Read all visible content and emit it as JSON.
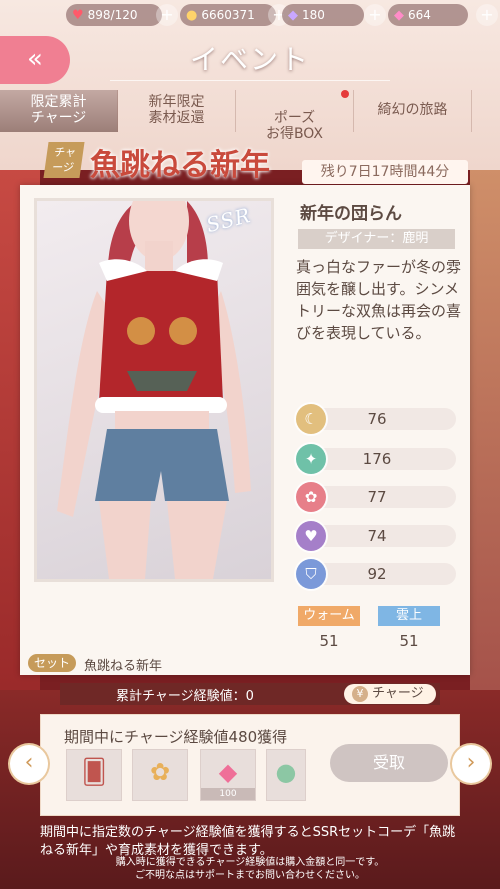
{
  "resources": {
    "stamina": "898/120",
    "coins": "6660371",
    "diamonds_purple": "180",
    "diamonds_pink": "664"
  },
  "header": {
    "back_label": "«",
    "title": "イベント"
  },
  "tabs": [
    {
      "label": "限定累計\nチャージ",
      "active": true
    },
    {
      "label": "新年限定\n素材返還"
    },
    {
      "label": "ポーズ\nお得BOX",
      "badge": true
    },
    {
      "label": "綺幻の旅路"
    }
  ],
  "event": {
    "tag": "チャ\nージ",
    "name": "魚跳ねる新年",
    "remaining": "残り7日17時間44分"
  },
  "item": {
    "rarity": "SSR",
    "name": "新年の団らん",
    "designer": "デザイナー：鹿明",
    "description": "真っ白なファーが冬の雰囲気を醸し出す。シンメトリーな双魚は再会の喜びを表現している。",
    "stats": [
      {
        "icon": "moon-icon",
        "value": "76",
        "color": "#e2bf7e"
      },
      {
        "icon": "sparkle-icon",
        "value": "176",
        "color": "#6fc1a8"
      },
      {
        "icon": "flower-icon",
        "value": "77",
        "color": "#e77f89"
      },
      {
        "icon": "heart-icon",
        "value": "74",
        "color": "#a57fc9"
      },
      {
        "icon": "shield-icon",
        "value": "92",
        "color": "#7b99d9"
      }
    ],
    "tags": [
      {
        "label": "ウォーム",
        "value": "51",
        "color": "#f0a968"
      },
      {
        "label": "雲上",
        "value": "51",
        "color": "#7fb6e4"
      }
    ],
    "set_label": "セット",
    "set_name": "魚跳ねる新年"
  },
  "exp": {
    "label": "累計チャージ経験値：0",
    "charge_button": "チャージ",
    "charge_icon": "¥"
  },
  "mission": {
    "title": "期間中にチャージ経験値480獲得",
    "receive_button": "受取",
    "rewards": [
      {
        "icon": "card-icon",
        "glyph": "🂠",
        "count": ""
      },
      {
        "icon": "ornament-icon",
        "glyph": "✿",
        "count": ""
      },
      {
        "icon": "diamond-icon",
        "glyph": "◆",
        "count": "100"
      },
      {
        "icon": "orb-icon",
        "glyph": "●",
        "count": ""
      }
    ]
  },
  "footer": {
    "main": "期間中に指定数のチャージ経験値を獲得するとSSRセットコーデ「魚跳ねる新年」や育成素材を獲得できます。",
    "note1": "購入時に獲得できるチャージ経験値は購入金額と同一です。",
    "note2": "ご不明な点はサポートまでお問い合わせください。"
  },
  "colors": {
    "accent_pink": "#f07f92",
    "gold": "#c69b5a",
    "bg_red": "#7a1f22"
  }
}
